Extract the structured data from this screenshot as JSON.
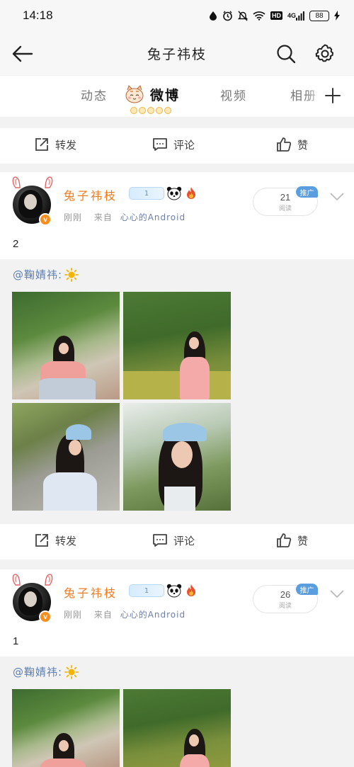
{
  "status_bar": {
    "time": "14:18",
    "battery": "88",
    "hd": "HD",
    "signal": "4G"
  },
  "top_nav": {
    "title": "兔子祎枝"
  },
  "tabs": [
    {
      "label": "动态"
    },
    {
      "label": "微博"
    },
    {
      "label": "视频"
    },
    {
      "label": "相册"
    }
  ],
  "actions": {
    "repost": "转发",
    "comment": "评论",
    "like": "赞"
  },
  "posts": [
    {
      "user": "兔子祎枝",
      "vip": "1",
      "time": "刚刚",
      "source_prefix": "来自",
      "source": "心心的Android",
      "reads": "21",
      "reads_label": "阅读",
      "promo": "推广",
      "text": "2",
      "mention": "@鞠婧祎:"
    },
    {
      "user": "兔子祎枝",
      "vip": "1",
      "time": "刚刚",
      "source_prefix": "来自",
      "source": "心心的Android",
      "reads": "26",
      "reads_label": "阅读",
      "promo": "推广",
      "text": "1",
      "mention": "@鞠婧祎:"
    }
  ],
  "colors": {
    "accent": "#ef7a1e",
    "link": "#5b7fb5",
    "promo": "#5a9ee0"
  }
}
